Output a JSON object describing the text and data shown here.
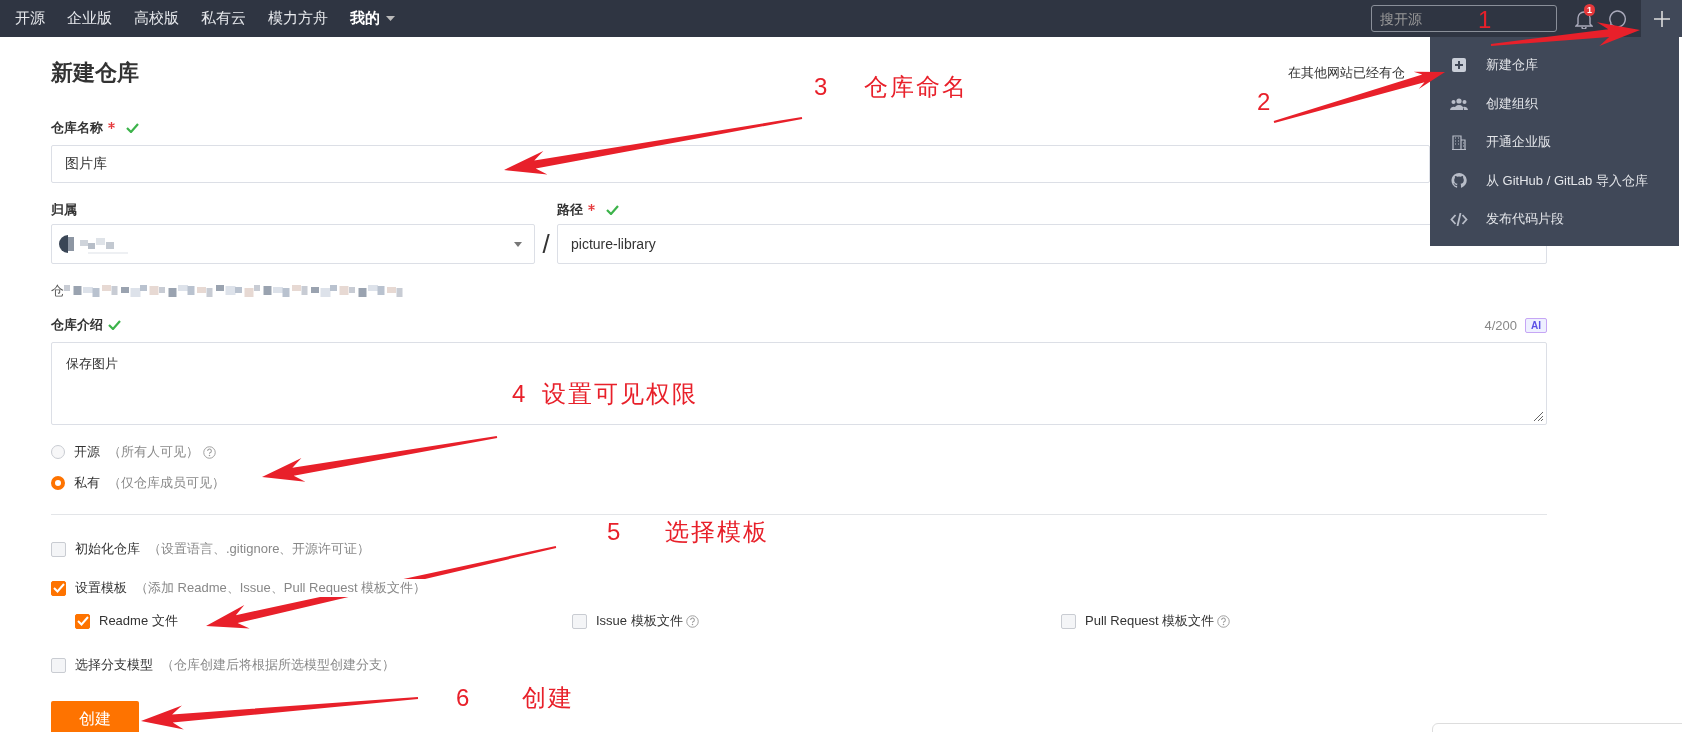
{
  "top_nav": {
    "links": [
      "开源",
      "企业版",
      "高校版",
      "私有云",
      "模力方舟"
    ],
    "my_menu": "我的",
    "search": {
      "placeholder": "搜开源"
    },
    "notification_count": "1"
  },
  "new_menu": {
    "expanded": true,
    "items": [
      {
        "kind": "plus",
        "label": "新建仓库"
      },
      {
        "kind": "group",
        "label": "创建组织"
      },
      {
        "kind": "building",
        "label": "开通企业版"
      },
      {
        "kind": "github",
        "label": "从 GitHub / GitLab 导入仓库"
      },
      {
        "kind": "code",
        "label": "发布代码片段"
      }
    ]
  },
  "page": {
    "title": "新建仓库",
    "import_hint": "在其他网站已经有仓"
  },
  "form": {
    "name": {
      "label": "仓库名称",
      "required": true,
      "valid": true,
      "value": "图片库"
    },
    "owner": {
      "label": "归属",
      "separator": "/"
    },
    "path": {
      "label": "路径",
      "required": true,
      "valid": true,
      "value": "picture-library"
    },
    "url_hint": "仓",
    "description": {
      "label": "仓库介绍",
      "valid": true,
      "counter": "4/200",
      "ai_label": "AI",
      "value": "保存图片"
    },
    "visibility": [
      {
        "label": "开源",
        "hint": "（所有人可见）",
        "help": true,
        "selected": false
      },
      {
        "label": "私有",
        "hint": "（仅仓库成员可见）",
        "help": false,
        "selected": true
      }
    ],
    "options": [
      {
        "label": "初始化仓库",
        "hint": "（设置语言、.gitignore、开源许可证）",
        "checked": false
      },
      {
        "label": "设置模板",
        "hint": "（添加 Readme、Issue、Pull Request 模板文件）",
        "checked": true,
        "children": [
          {
            "label": "Readme 文件",
            "checked": true,
            "help": false
          },
          {
            "label": "Issue 模板文件",
            "checked": false,
            "help": true
          },
          {
            "label": "Pull Request 模板文件",
            "checked": false,
            "help": true
          }
        ]
      },
      {
        "label": "选择分支模型",
        "hint": "（仓库创建后将根据所选模型创建分支）",
        "checked": false
      }
    ],
    "submit": "创建"
  },
  "annotations": [
    {
      "number": "1"
    },
    {
      "number": "2"
    },
    {
      "number": "3",
      "label": "仓库命名"
    },
    {
      "number": "4",
      "label": "设置可见权限"
    },
    {
      "number": "5",
      "label": "选择模板"
    },
    {
      "number": "6",
      "label": "创建"
    }
  ]
}
